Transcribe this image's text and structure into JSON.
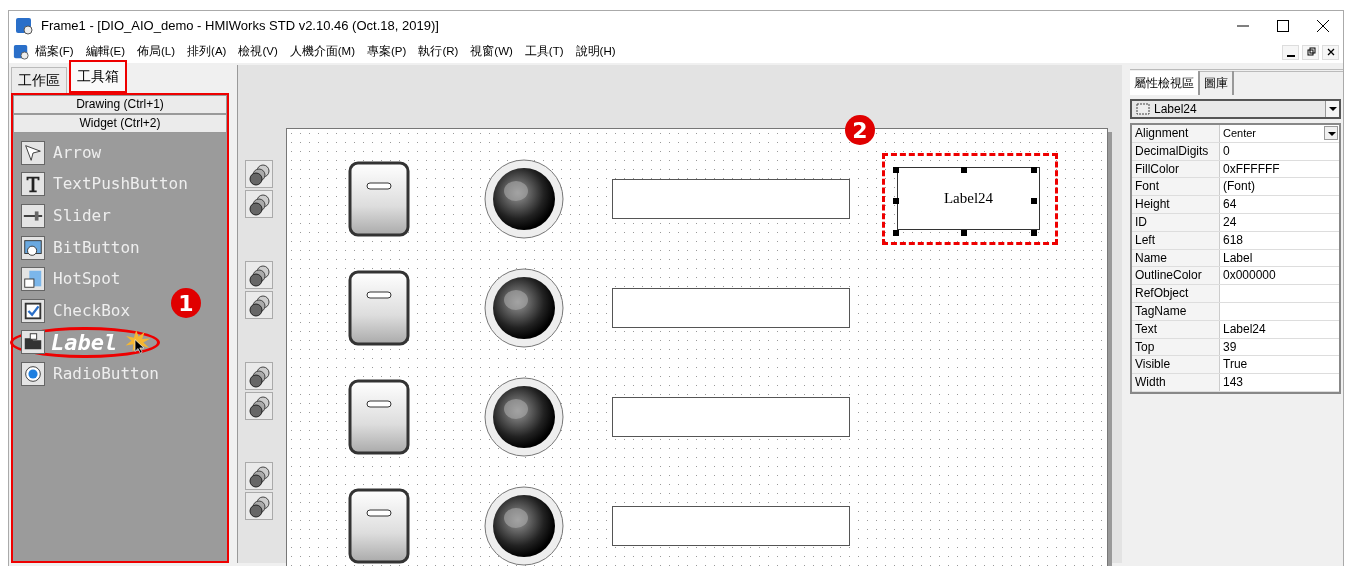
{
  "window": {
    "title": "Frame1 - [DIO_AIO_demo - HMIWorks STD v2.10.46 (Oct.18, 2019)]"
  },
  "menu": [
    "檔案(F)",
    "編輯(E)",
    "佈局(L)",
    "排列(A)",
    "檢視(V)",
    "人機介面(M)",
    "專案(P)",
    "執行(R)",
    "視窗(W)",
    "工具(T)",
    "說明(H)"
  ],
  "left_panel": {
    "tabs": [
      {
        "label": "工作區",
        "selected": false
      },
      {
        "label": "工具箱",
        "selected": true
      }
    ],
    "sections": [
      "Drawing (Ctrl+1)",
      "Widget (Ctrl+2)"
    ],
    "tools": [
      {
        "label": "Arrow",
        "selected": false
      },
      {
        "label": "TextPushButton",
        "selected": false
      },
      {
        "label": "Slider",
        "selected": false
      },
      {
        "label": "BitButton",
        "selected": false
      },
      {
        "label": "HotSpot",
        "selected": false
      },
      {
        "label": "CheckBox",
        "selected": false
      },
      {
        "label": "Label",
        "selected": true
      },
      {
        "label": "RadioButton",
        "selected": false
      }
    ],
    "callout": "1"
  },
  "canvas": {
    "label_widget": {
      "text": "Label24",
      "selected": true
    },
    "callout": "2"
  },
  "properties": {
    "tabs": [
      {
        "label": "屬性檢視區",
        "selected": true
      },
      {
        "label": "圖庫",
        "selected": false
      }
    ],
    "object": "Label24",
    "rows": [
      {
        "name": "Alignment",
        "value": "Center",
        "kind": "dropdown"
      },
      {
        "name": "DecimalDigits",
        "value": "0",
        "kind": "text"
      },
      {
        "name": "FillColor",
        "value": "0xFFFFFF",
        "kind": "text"
      },
      {
        "name": "Font",
        "value": "(Font)",
        "kind": "text"
      },
      {
        "name": "Height",
        "value": "64",
        "kind": "text"
      },
      {
        "name": "ID",
        "value": "24",
        "kind": "text"
      },
      {
        "name": "Left",
        "value": "618",
        "kind": "text"
      },
      {
        "name": "Name",
        "value": "Label",
        "kind": "text"
      },
      {
        "name": "OutlineColor",
        "value": "0x000000",
        "kind": "text"
      },
      {
        "name": "RefObject",
        "value": "",
        "kind": "text"
      },
      {
        "name": "TagName",
        "value": "",
        "kind": "text"
      },
      {
        "name": "Text",
        "value": "Label24",
        "kind": "text"
      },
      {
        "name": "Top",
        "value": "39",
        "kind": "text"
      },
      {
        "name": "Visible",
        "value": "True",
        "kind": "text"
      },
      {
        "name": "Width",
        "value": "143",
        "kind": "text"
      }
    ]
  }
}
